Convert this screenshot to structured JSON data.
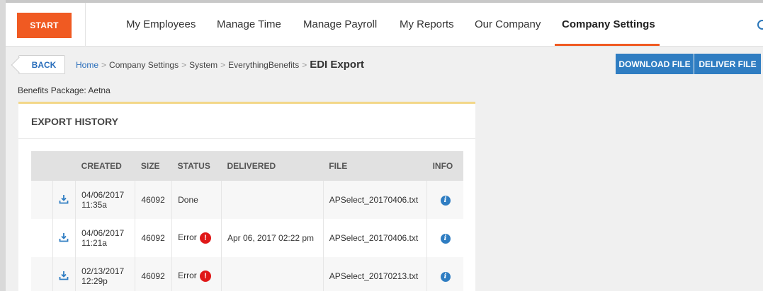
{
  "nav": {
    "start_label": "START",
    "items": [
      "My Employees",
      "Manage Time",
      "Manage Payroll",
      "My Reports",
      "Our Company",
      "Company Settings"
    ],
    "active": "Company Settings"
  },
  "breadcrumb": {
    "back_label": "BACK",
    "home": "Home",
    "parts": [
      "Company Settings",
      "System",
      "EverythingBenefits"
    ],
    "current": "EDI Export",
    "separator": ">"
  },
  "actions": {
    "download_label": "DOWNLOAD FILE",
    "deliver_label": "DELIVER FILE"
  },
  "package_label": "Benefits Package: Aetna",
  "export_history": {
    "title": "EXPORT HISTORY",
    "columns": [
      "",
      "CREATED",
      "SIZE",
      "STATUS",
      "DELIVERED",
      "FILE",
      "INFO"
    ],
    "rows": [
      {
        "created_date": "04/06/2017",
        "created_time": "11:35a",
        "size": "46092",
        "status": "Done",
        "error": false,
        "delivered": "",
        "file": "APSelect_20170406.txt"
      },
      {
        "created_date": "04/06/2017",
        "created_time": "11:21a",
        "size": "46092",
        "status": "Error",
        "error": true,
        "delivered": "Apr 06, 2017 02:22 pm",
        "file": "APSelect_20170406.txt"
      },
      {
        "created_date": "02/13/2017",
        "created_time": "12:29p",
        "size": "46092",
        "status": "Error",
        "error": true,
        "delivered": "",
        "file": "APSelect_20170213.txt"
      }
    ]
  },
  "icons": {
    "search": "search-icon",
    "download": "download-icon",
    "info": "info-icon",
    "error": "error-icon"
  },
  "colors": {
    "accent": "#f05a22",
    "primary": "#2f7dc2",
    "error": "#e01818"
  }
}
